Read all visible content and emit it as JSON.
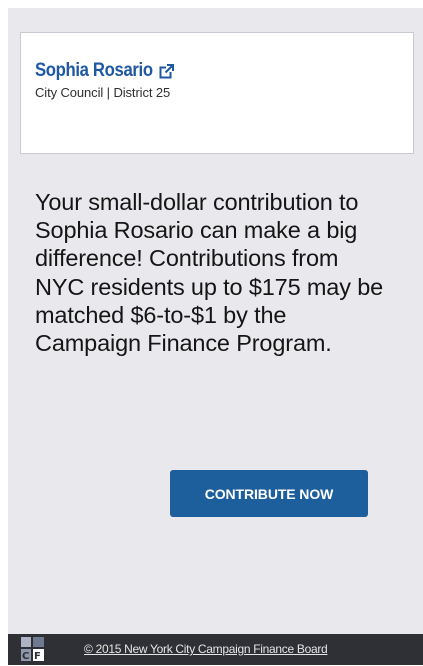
{
  "candidate": {
    "name": "Sophia Rosario",
    "office": "City Council | District 25",
    "name_color": "#1f58a2",
    "external_icon": "external-link-icon"
  },
  "message": "Your small-dollar contribution to Sophia Rosario can make a big difference! Contributions from NYC residents up to $175 may be matched $6-to-$1 by the Campaign Finance Program.",
  "button": {
    "label": "CONTRIBUTE NOW",
    "color": "#1d5f9d"
  },
  "footer": {
    "link_text": "© 2015 New York City Campaign Finance Board",
    "logo_icon": "cfb-logo-icon",
    "background": "#2f3035"
  },
  "colors": {
    "panel_background": "#e9e9ed",
    "card_background": "#ffffff"
  }
}
